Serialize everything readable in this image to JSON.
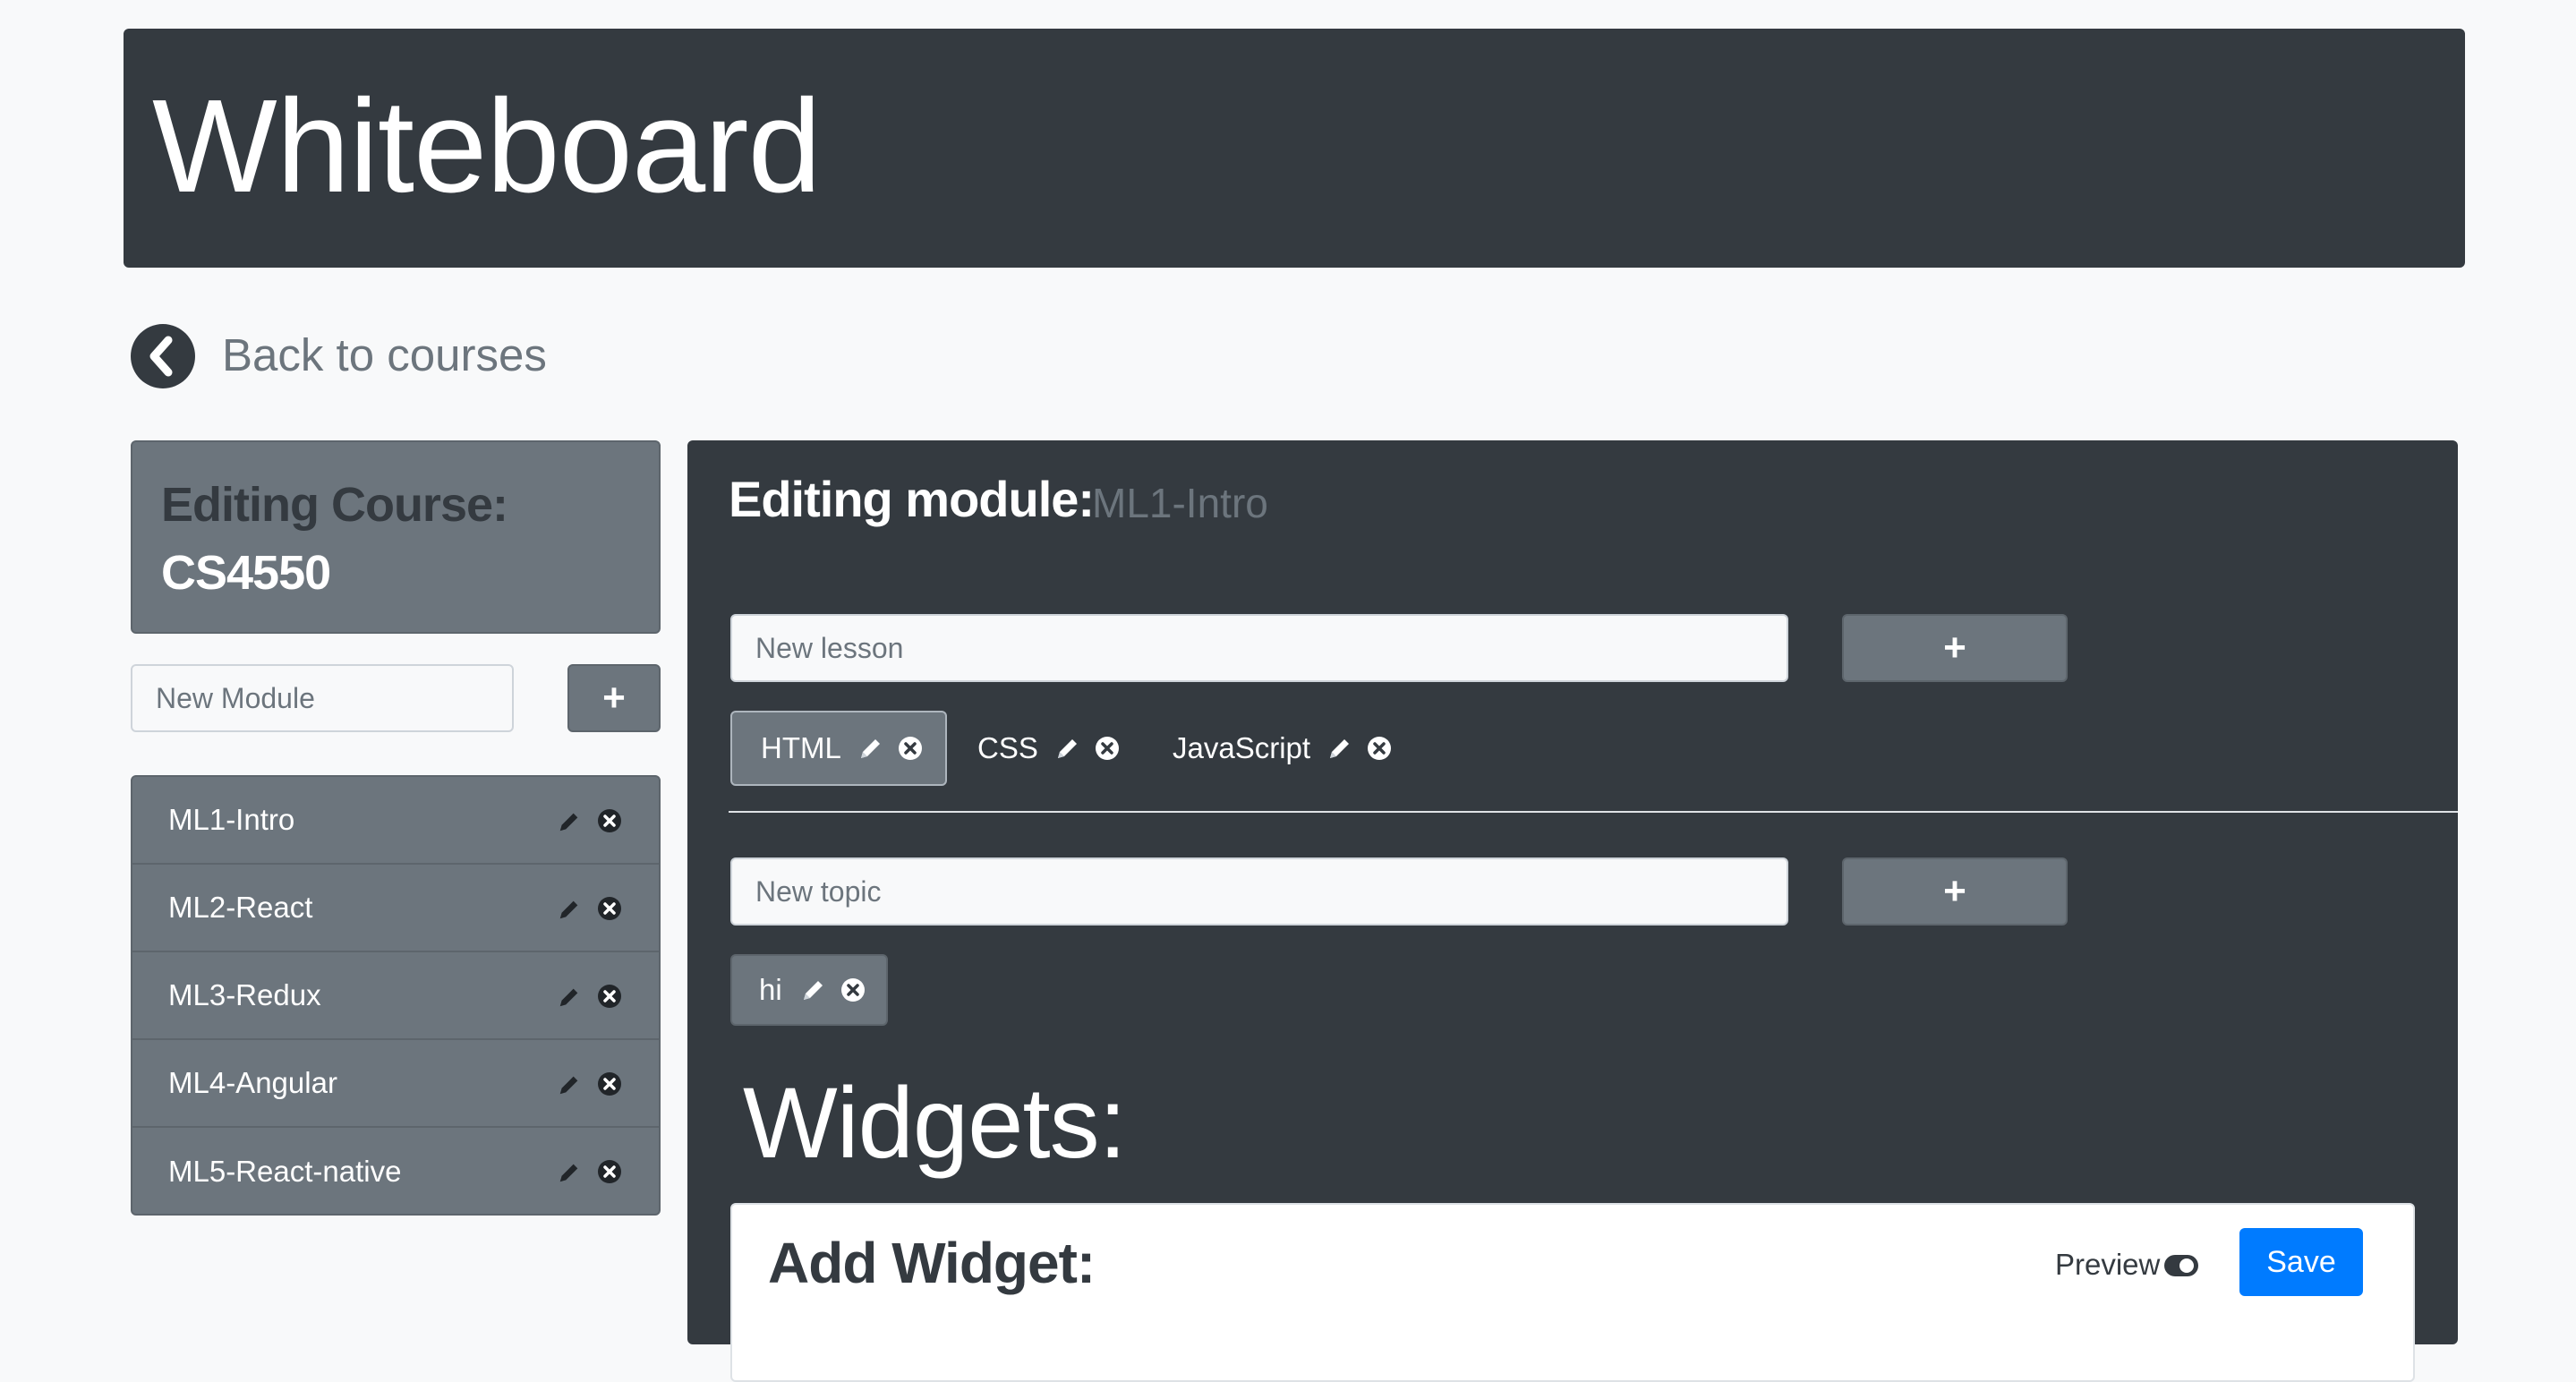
{
  "header": {
    "title": "Whiteboard"
  },
  "nav": {
    "back_label": "Back to courses"
  },
  "course": {
    "heading": "Editing Course:",
    "name": "CS4550"
  },
  "module_form": {
    "placeholder": "New Module",
    "add_label": "+"
  },
  "modules": [
    {
      "label": "ML1-Intro"
    },
    {
      "label": "ML2-React"
    },
    {
      "label": "ML3-Redux"
    },
    {
      "label": "ML4-Angular"
    },
    {
      "label": "ML5-React-native"
    }
  ],
  "editor": {
    "heading": "Editing module:",
    "module_name": "ML1-Intro",
    "lesson_placeholder": "New lesson",
    "lesson_add_label": "+",
    "lessons": [
      {
        "label": "HTML",
        "active": true
      },
      {
        "label": "CSS",
        "active": false
      },
      {
        "label": "JavaScript",
        "active": false
      }
    ],
    "topic_placeholder": "New topic",
    "topic_add_label": "+",
    "topics": [
      {
        "label": "hi"
      }
    ]
  },
  "widgets": {
    "title": "Widgets:",
    "add_title": "Add Widget:",
    "preview_label": "Preview",
    "save_label": "Save"
  },
  "icons": [
    "chevron-left-circle-icon",
    "pencil-icon",
    "times-circle-icon",
    "toggle-icon"
  ],
  "colors": {
    "dark": "#343a40",
    "secondary": "#6c757d",
    "primary": "#007bff",
    "light": "#f8f9fa"
  }
}
